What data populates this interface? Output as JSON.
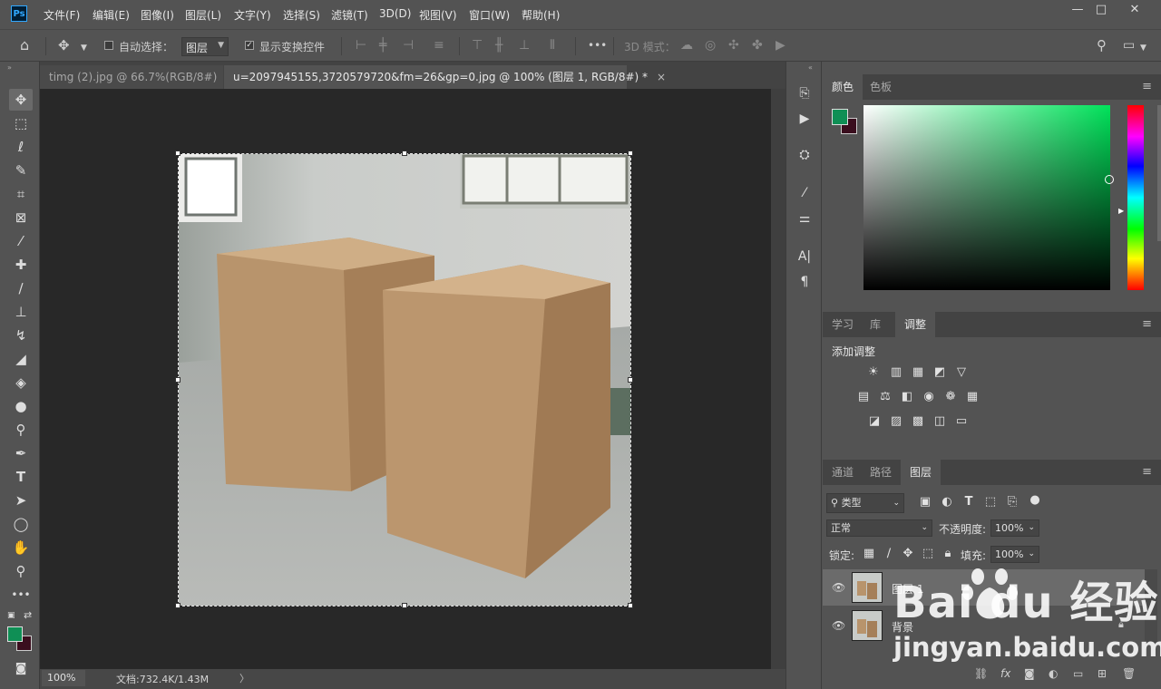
{
  "app": {
    "logo_text": "Ps"
  },
  "menu": [
    "文件(F)",
    "编辑(E)",
    "图像(I)",
    "图层(L)",
    "文字(Y)",
    "选择(S)",
    "滤镜(T)",
    "3D(D)",
    "视图(V)",
    "窗口(W)",
    "帮助(H)"
  ],
  "window_controls": {
    "minimize": "—",
    "maximize": "□",
    "close": "✕"
  },
  "options_bar": {
    "auto_select_label": "自动选择：",
    "auto_select_checked": false,
    "layer_dropdown_value": "图层",
    "show_transform_label": "显示变换控件",
    "show_transform_checked": true,
    "more": "•••",
    "mode_3d_label": "3D 模式："
  },
  "tabs": [
    {
      "title": "timg (2).jpg @ 66.7%(RGB/8#)",
      "close": "×",
      "active": false
    },
    {
      "title": "u=2097945155,3720579720&fm=26&gp=0.jpg @ 100% (图层 1, RGB/8#) *",
      "close": "×",
      "active": true
    }
  ],
  "status": {
    "zoom": "100%",
    "doc_size": "文档:732.4K/1.43M",
    "arrow": "〉"
  },
  "colors": {
    "foreground": "#0f8f55",
    "background": "#3a0e1e",
    "accent": "#31a8ff"
  },
  "color_panel": {
    "tabs": [
      "颜色",
      "色板"
    ],
    "active": 0
  },
  "adjust_panel": {
    "tabs": [
      "学习",
      "库",
      "调整"
    ],
    "active": 2,
    "heading": "添加调整"
  },
  "layers_panel": {
    "tabs": [
      "通道",
      "路径",
      "图层"
    ],
    "active": 2,
    "kind_filter": "类型",
    "blend_mode": "正常",
    "opacity_label": "不透明度:",
    "opacity_value": "100%",
    "lock_label": "锁定:",
    "fill_label": "填充:",
    "fill_value": "100%",
    "layers": [
      {
        "name": "图层 1",
        "visible": true,
        "selected": true,
        "locked": false
      },
      {
        "name": "背景",
        "visible": true,
        "selected": false,
        "locked": true
      }
    ]
  },
  "watermark": {
    "logo": "Bai  du 经验",
    "url": "jingyan.baidu.com"
  },
  "icons": {
    "home": "home-icon",
    "move": "move-icon",
    "search": "search-icon",
    "workspace": "workspace-icon"
  }
}
